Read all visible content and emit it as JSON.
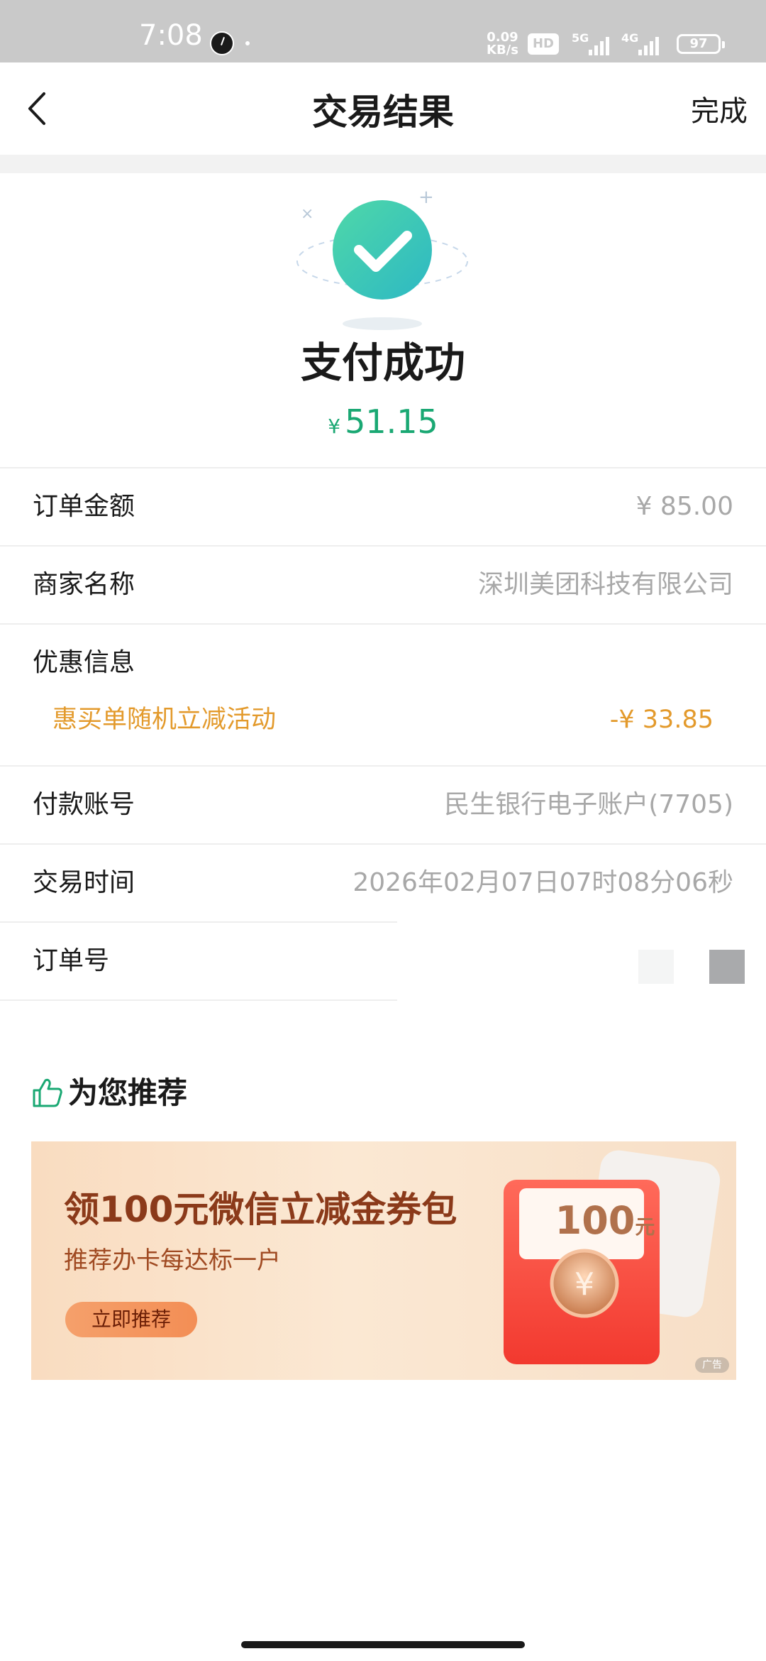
{
  "status_bar": {
    "time": "7:08",
    "net_speed_value": "0.09",
    "net_speed_unit": "KB/s",
    "hd_label": "HD",
    "network_1": "5G",
    "network_2": "4G",
    "battery": "97"
  },
  "nav": {
    "title": "交易结果",
    "done_label": "完成"
  },
  "result": {
    "status": "支付成功",
    "currency_symbol": "¥",
    "amount": "51.15"
  },
  "details": {
    "order_amount_label": "订单金额",
    "order_amount_value": "¥ 85.00",
    "merchant_label": "商家名称",
    "merchant_value": "深圳美团科技有限公司",
    "discount_label": "优惠信息",
    "discount_name": "惠买单随机立减活动",
    "discount_value": "-¥ 33.85",
    "account_label": "付款账号",
    "account_value": "民生银行电子账户(7705)",
    "time_label": "交易时间",
    "time_value": "2026年02月07日07时08分06秒",
    "order_no_label": "订单号"
  },
  "recommend": {
    "title": "为您推荐",
    "banner_title": "领100元微信立减金券包",
    "banner_subtitle": "推荐办卡每达标一户",
    "banner_button": "立即推荐",
    "coupon_amount": "100",
    "coupon_unit": "元",
    "ad_tag": "广告"
  },
  "colors": {
    "accent_green": "#1aa873",
    "discount_orange": "#e39a2c",
    "banner_text": "#8b3a1a"
  },
  "icons": [
    "back-arrow-icon",
    "success-check-icon",
    "thumbs-up-icon",
    "yuan-coin-icon"
  ]
}
